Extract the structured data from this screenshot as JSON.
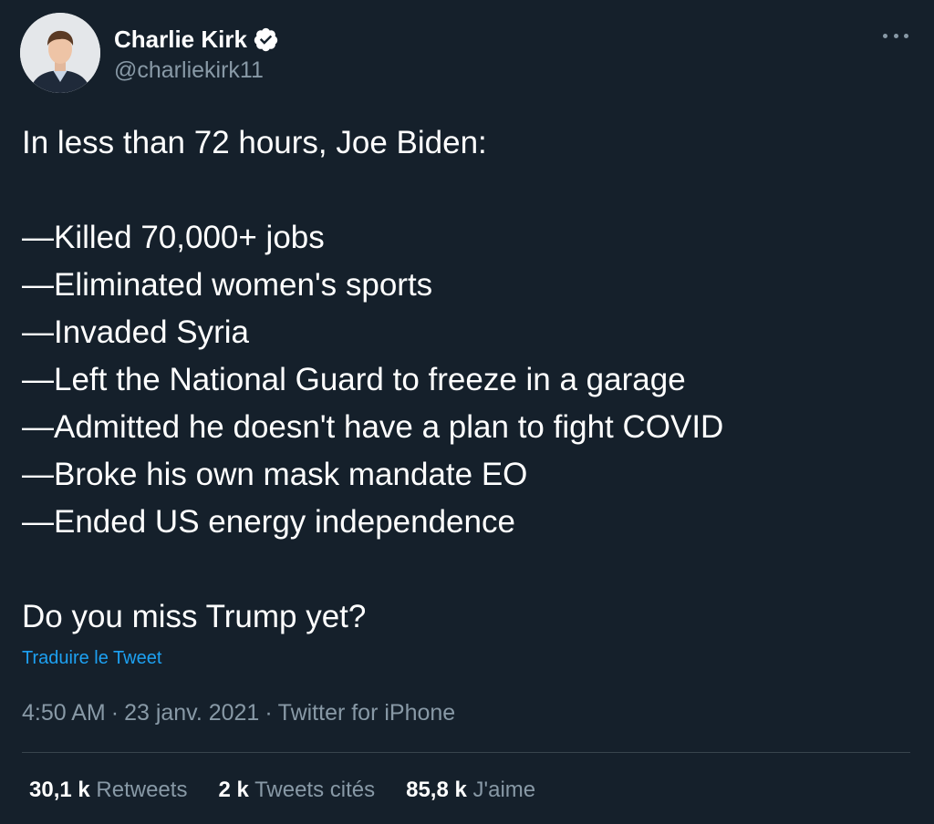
{
  "author": {
    "display_name": "Charlie Kirk",
    "handle": "@charliekirk11",
    "verified": true,
    "avatar_icon": "profile-photo"
  },
  "tweet": {
    "lines": [
      "In less than 72 hours, Joe Biden:",
      "",
      "—Killed 70,000+ jobs",
      "—Eliminated women's sports",
      "—Invaded Syria",
      "—Left the National Guard to freeze in a garage",
      "—Admitted he doesn't have a plan to fight COVID",
      "—Broke his own mask mandate EO",
      "—Ended US energy independence",
      "",
      "Do you miss Trump yet?"
    ],
    "translate_label": "Traduire le Tweet",
    "time": "4:50 AM",
    "date": "23 janv. 2021",
    "source": "Twitter for iPhone",
    "separator": "·"
  },
  "stats": {
    "retweets_count": "30,1 k",
    "retweets_label": "Retweets",
    "quotes_count": "2 k",
    "quotes_label": "Tweets cités",
    "likes_count": "85,8 k",
    "likes_label": "J'aime"
  },
  "colors": {
    "background": "#15202b",
    "text": "#ffffff",
    "secondary": "#8899a6",
    "link": "#1da1f2",
    "divider": "#38444d"
  }
}
